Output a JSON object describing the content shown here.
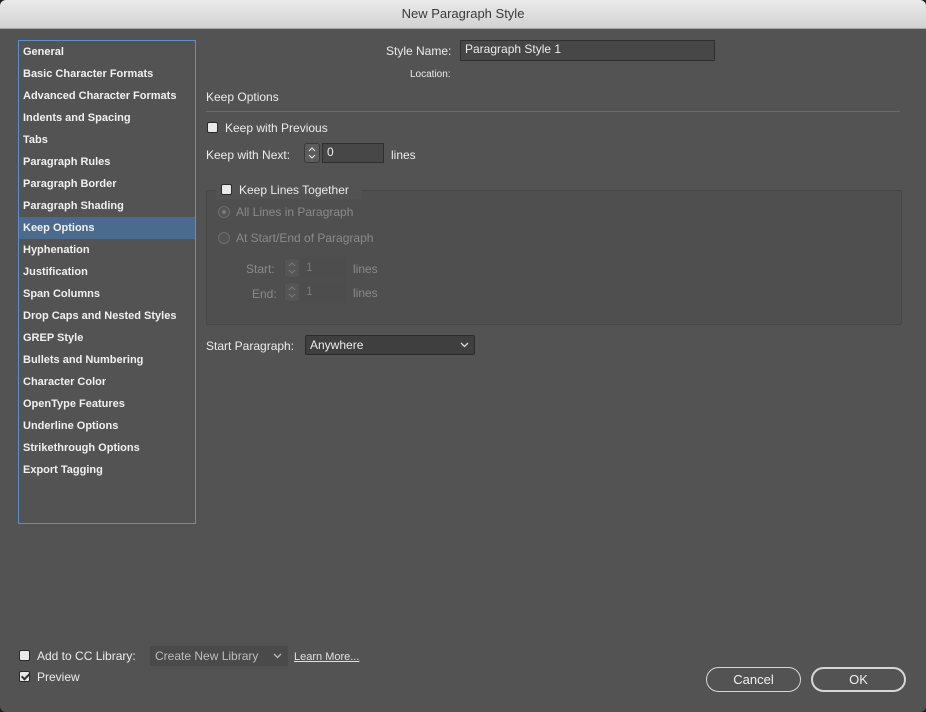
{
  "window": {
    "title": "New Paragraph Style"
  },
  "sidebar": {
    "items": [
      {
        "label": "General"
      },
      {
        "label": "Basic Character Formats"
      },
      {
        "label": "Advanced Character Formats"
      },
      {
        "label": "Indents and Spacing"
      },
      {
        "label": "Tabs"
      },
      {
        "label": "Paragraph Rules"
      },
      {
        "label": "Paragraph Border"
      },
      {
        "label": "Paragraph Shading"
      },
      {
        "label": "Keep Options",
        "selected": true
      },
      {
        "label": "Hyphenation"
      },
      {
        "label": "Justification"
      },
      {
        "label": "Span Columns"
      },
      {
        "label": "Drop Caps and Nested Styles"
      },
      {
        "label": "GREP Style"
      },
      {
        "label": "Bullets and Numbering"
      },
      {
        "label": "Character Color"
      },
      {
        "label": "OpenType Features"
      },
      {
        "label": "Underline Options"
      },
      {
        "label": "Strikethrough Options"
      },
      {
        "label": "Export Tagging"
      }
    ]
  },
  "style": {
    "name_label": "Style Name:",
    "name_value": "Paragraph Style 1",
    "location_label": "Location:"
  },
  "keep": {
    "section_title": "Keep Options",
    "keep_with_previous_label": "Keep with Previous",
    "keep_with_previous_checked": false,
    "keep_with_next_label": "Keep with Next:",
    "keep_with_next_value": "0",
    "keep_with_next_unit": "lines",
    "keep_lines_together_label": "Keep Lines Together",
    "keep_lines_together_checked": false,
    "all_lines_label": "All Lines in Paragraph",
    "start_end_label": "At Start/End of Paragraph",
    "start_label": "Start:",
    "start_value": "1",
    "start_unit": "lines",
    "end_label": "End:",
    "end_value": "1",
    "end_unit": "lines",
    "start_paragraph_label": "Start Paragraph:",
    "start_paragraph_value": "Anywhere"
  },
  "footer": {
    "add_cc_label": "Add to CC Library:",
    "add_cc_checked": false,
    "library_value": "Create New Library",
    "learn_more": "Learn More...",
    "preview_label": "Preview",
    "preview_checked": true,
    "cancel_label": "Cancel",
    "ok_label": "OK"
  },
  "colors": {
    "dialog_bg": "#535353",
    "selection": "#4b6b8e",
    "sidebar_border": "#5d8fd0"
  }
}
